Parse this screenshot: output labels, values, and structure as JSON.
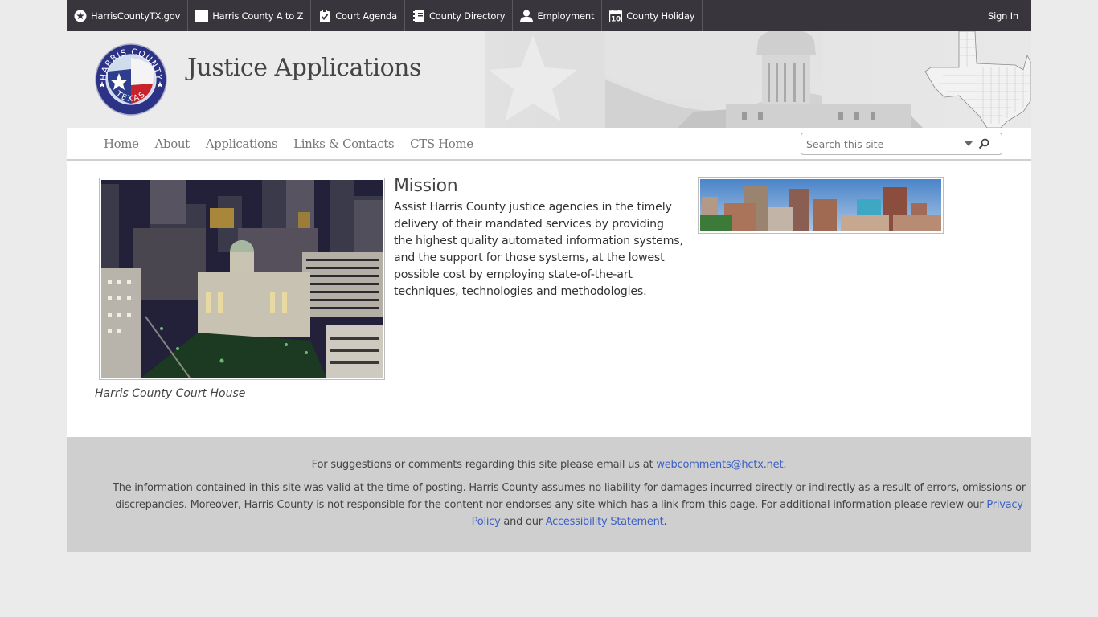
{
  "topbar": {
    "links": [
      {
        "label": "HarrisCountyTX.gov",
        "icon": "star-circle-icon"
      },
      {
        "label": "Harris County A to Z",
        "icon": "list-icon"
      },
      {
        "label": "Court Agenda",
        "icon": "clipboard-check-icon"
      },
      {
        "label": "County Directory",
        "icon": "address-book-icon"
      },
      {
        "label": "Employment",
        "icon": "person-icon"
      },
      {
        "label": "County Holiday",
        "icon": "calendar-icon",
        "icon_text": "10"
      }
    ],
    "sign_in": "Sign In"
  },
  "banner": {
    "site_title": "Justice Applications",
    "logo": {
      "top_text": "HARRIS COUNTY",
      "bottom_text": "TEXAS"
    }
  },
  "nav": {
    "items": [
      {
        "label": "Home"
      },
      {
        "label": "About"
      },
      {
        "label": "Applications"
      },
      {
        "label": "Links & Contacts"
      },
      {
        "label": "CTS Home"
      }
    ],
    "search": {
      "placeholder": "Search this site"
    }
  },
  "content": {
    "main_photo_caption": "Harris County Court House",
    "mission": {
      "heading": "Mission",
      "text": "Assist Harris County justice agencies in the timely delivery of their mandated services by providing the highest quality automated information systems, and the support for those systems, at the lowest possible cost by employing state-of-the-art techniques, technologies and methodologies."
    }
  },
  "footer": {
    "line1_prefix": "For suggestions or comments regarding this site please email us at ",
    "email": "webcomments@hctx.net",
    "line1_suffix": ".",
    "line2_prefix": "The information contained in this site was valid at the time of posting. Harris County assumes no liability for damages incurred directly or indirectly as a result of errors, omissions or discrepancies. Moreover, Harris County is not responsible for the content nor endorses any site which has a link from this page. For additional information please review our ",
    "privacy_link": "Privacy Policy",
    "line2_middle": " and our ",
    "accessibility_link": "Accessibility Statement",
    "line2_suffix": "."
  },
  "colors": {
    "topbar_bg": "#38363c",
    "page_bg": "#ebebeb",
    "footer_bg": "#cfcfcf",
    "link": "#3b5fc4"
  }
}
